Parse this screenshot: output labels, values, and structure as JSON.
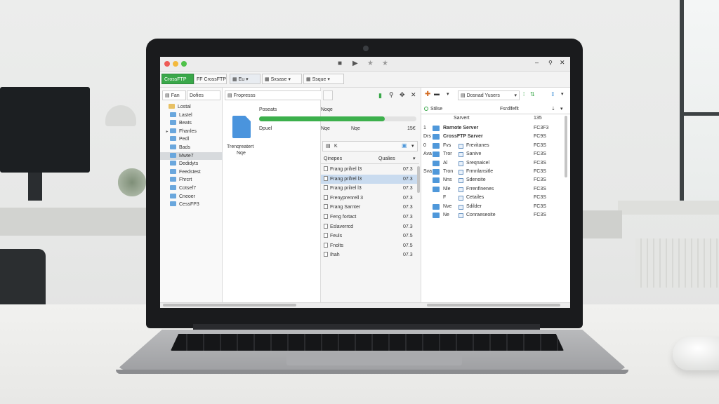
{
  "colors": {
    "accent": "#3aa84a",
    "folder": "#4f98da",
    "selection": "#c9dbef"
  },
  "titlebar": {
    "icons": [
      "stop-icon",
      "play-icon",
      "star-icon",
      "star-outline-icon"
    ],
    "minimize": "–",
    "close": "✕"
  },
  "toolbar": {
    "tabs": [
      {
        "label": "CrossFTP",
        "active": true
      },
      {
        "label": "FF CrossFTP",
        "active": false
      },
      {
        "label": "Eu",
        "active": false
      },
      {
        "label": "Sxsase",
        "active": false
      },
      {
        "label": "Ssque",
        "active": false
      }
    ]
  },
  "left_pane": {
    "filter_a": "Fan",
    "filter_b": "Dofies",
    "tree": [
      {
        "label": "Lostal",
        "selected": false,
        "caret": ""
      },
      {
        "label": "Lastel",
        "selected": false,
        "caret": ""
      },
      {
        "label": "Beats",
        "selected": false,
        "caret": ""
      },
      {
        "label": "Fhanles",
        "selected": false,
        "caret": "▸"
      },
      {
        "label": "Pedl",
        "selected": false,
        "caret": ""
      },
      {
        "label": "Bads",
        "selected": false,
        "caret": ""
      },
      {
        "label": "Mwte7",
        "selected": true,
        "caret": ""
      },
      {
        "label": "Dedidyts",
        "selected": false,
        "caret": ""
      },
      {
        "label": "Feedstest",
        "selected": false,
        "caret": ""
      },
      {
        "label": "Fhrcrt",
        "selected": false,
        "caret": ""
      },
      {
        "label": "Cotsef7",
        "selected": false,
        "caret": ""
      },
      {
        "label": "Cneoer",
        "selected": false,
        "caret": ""
      },
      {
        "label": "CessFP3",
        "selected": false,
        "caret": ""
      }
    ]
  },
  "progress": {
    "search_value": "Fropresss",
    "col_left_title": "Poseats",
    "col_right_title": "Noqe",
    "fraction": 0.8,
    "row_label": "Dpuel",
    "row_mid_a": "Nqe",
    "row_mid_b": "Nqe",
    "row_value": "15€",
    "caption_line1": "Trenqreatert",
    "caption_line2": "Nqe"
  },
  "queue": {
    "header_label": "K",
    "col_name": "Qinepes",
    "col_status": "Qualies",
    "rows": [
      {
        "name": "Frang prifrel l3",
        "value": "07.3",
        "selected": false
      },
      {
        "name": "Frang prifrel l3",
        "value": "07.3",
        "selected": true
      },
      {
        "name": "Frang prilrel l3",
        "value": "07.3",
        "selected": false
      },
      {
        "name": "Frenyprenrell 3",
        "value": "07.3",
        "selected": false
      },
      {
        "name": "Frang Sarnter",
        "value": "07.3",
        "selected": false
      },
      {
        "name": "Feng fortact",
        "value": "07.3",
        "selected": false
      },
      {
        "name": "Eslaverrcd",
        "value": "07.3",
        "selected": false
      },
      {
        "name": "Feuls",
        "value": "07.5",
        "selected": false
      },
      {
        "name": "Fnolts",
        "value": "07.5",
        "selected": false
      },
      {
        "name": "Ihah",
        "value": "07.3",
        "selected": false
      }
    ]
  },
  "remote": {
    "location": "Dosnad Yusers",
    "col_status": "Stilse",
    "col_name": "Sarvert",
    "col_mod": "Fsrdlfeflt",
    "col_size": "135",
    "rows": [
      {
        "left": "1",
        "name": "Rarnote Server",
        "right_name": "",
        "size": "FC3F3",
        "big": true,
        "small": false
      },
      {
        "left": "Drs",
        "name": "CrossFTP Sarver",
        "right_name": "",
        "size": "FC9S",
        "big": true,
        "small": false
      },
      {
        "left": "0",
        "name": "Fvs",
        "right_name": "Frevitanes",
        "size": "FC3S",
        "big": true,
        "small": true
      },
      {
        "left": "Ava",
        "name": "Tror",
        "right_name": "Sanive",
        "size": "FC3S",
        "big": true,
        "small": true
      },
      {
        "left": "",
        "name": "Al",
        "right_name": "Sreqnaicel",
        "size": "FC3S",
        "big": true,
        "small": true
      },
      {
        "left": "Sva",
        "name": "Tron",
        "right_name": "Frmnlansitle",
        "size": "FC3S",
        "big": true,
        "small": true
      },
      {
        "left": "",
        "name": "Nns",
        "right_name": "Sdenoite",
        "size": "FC3S",
        "big": true,
        "small": true
      },
      {
        "left": "",
        "name": "Nle",
        "right_name": "Frrenfinenes",
        "size": "FC3S",
        "big": true,
        "small": true
      },
      {
        "left": "",
        "name": "F",
        "right_name": "Cetailes",
        "size": "FC3S",
        "big": false,
        "small": true
      },
      {
        "left": "",
        "name": "Nve",
        "right_name": "Sdilder",
        "size": "FC3S",
        "big": true,
        "small": true
      },
      {
        "left": "",
        "name": "Ne",
        "right_name": "Conraeseoite",
        "size": "FC3S",
        "big": true,
        "small": true
      }
    ]
  }
}
